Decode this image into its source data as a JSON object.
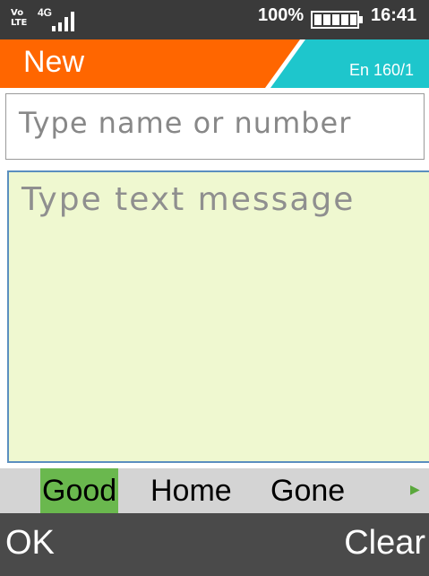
{
  "status_bar": {
    "volte_line1": "Vo",
    "volte_line2": "LTE",
    "network": "4G",
    "signal_icon": "signal-bars-icon",
    "battery_percent": "100%",
    "battery_icon": "battery-icon",
    "battery_level": 1.0,
    "time": "16:41"
  },
  "header": {
    "title": "New",
    "char_counter": "En 160/1"
  },
  "recipient": {
    "placeholder": "Type name or number"
  },
  "message": {
    "placeholder": "Type text message"
  },
  "suggestions": {
    "items": [
      "Good",
      "Home",
      "Gone"
    ],
    "selected": "Good",
    "more_icon": "triangle-right-icon"
  },
  "softkeys": {
    "left": "OK",
    "right": "Clear"
  },
  "colors": {
    "status_bar": "#3a3a3a",
    "header_orange": "#ff6600",
    "header_cyan": "#1ec6cc",
    "message_bg": "#eff8d0",
    "focus_border": "#5b8fbf",
    "suggestion_bg": "#d4d4d4",
    "suggestion_selected": "#6ab84e",
    "softkey_bar": "#4a4a4a"
  }
}
